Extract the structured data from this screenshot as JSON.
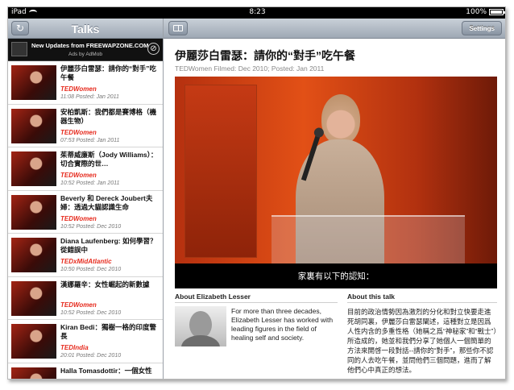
{
  "status": {
    "device": "iPad",
    "time": "8:23",
    "battery": "100%",
    "battery_level": 1.0
  },
  "left": {
    "title": "Talks",
    "ad": {
      "headline": "New Updates from FREEWAPZONE.COM",
      "byline": "Ads by AdMob"
    },
    "talks": [
      {
        "title": "伊麗莎白雷瑟：請你的“對手”吃午餐",
        "event": "TEDWomen",
        "meta": "11:08 Posted: Jan 2011"
      },
      {
        "title": "安柏凱斯：我們都是賽博格（機器生物）",
        "event": "TEDWomen",
        "meta": "07:53 Posted: Jan 2011"
      },
      {
        "title": "茱蒂威廉斯（Jody Williams）：切合實際的世…",
        "event": "TEDWomen",
        "meta": "10:52 Posted: Jan 2011"
      },
      {
        "title": "Beverly 和 Dereck Joubert夫婦：透過大貓認識生命",
        "event": "TEDWomen",
        "meta": "10:52 Posted: Dec 2010"
      },
      {
        "title": "Diana Laufenberg: 如何學習？從錯誤中",
        "event": "TEDxMidAtlantic",
        "meta": "10:50 Posted: Dec 2010"
      },
      {
        "title": "漢娜羅辛：女性崛起的新數據",
        "event": "TEDWomen",
        "meta": "10:52 Posted: Dec 2010"
      },
      {
        "title": "Kiran Bedi：獨樹一格的印度警長",
        "event": "TEDIndia",
        "meta": "20:01 Posted: Dec 2010"
      },
      {
        "title": "Halla Tomasdottir：一個女性",
        "event": "",
        "meta": ""
      }
    ]
  },
  "right": {
    "settings_label": "Settings",
    "talk_title": "伊麗莎白雷瑟：請你的“對手”吃午餐",
    "talk_meta": "TEDWomen Filmed: Dec 2010; Posted: Jan 2011",
    "subtitle": "家裏有以下的認知：",
    "about_speaker_label": "About Elizabeth Lesser",
    "about_talk_label": "About this talk",
    "speaker_bio": "For more than three decades, Elizabeth Lesser has worked with leading figures in the field of healing self and society.",
    "talk_description": "目前的政治情勢因為激烈的分化和對立快要走進死胡同裏，伊麗莎白雷瑟闡述，這種對立是因爲人性内含的多重性格（她稱之爲“神秘家”和“戰士”）所造成的，她並和我們分享了她個人一個簡單的方法來開啓一段對話--請你的“對手”，那些你不認同的人去吃午餐，並問他們三個問題，進而了解他們心中真正的想法。"
  },
  "colors": {
    "ted_red": "#e62b1e",
    "nav_top": "#c9d0d8",
    "nav_bottom": "#9ea8b4"
  },
  "icons": {
    "refresh": "refresh-icon",
    "bookmarks": "book-icon",
    "ad_close": "close-icon",
    "ad_logo": "chart-icon"
  }
}
